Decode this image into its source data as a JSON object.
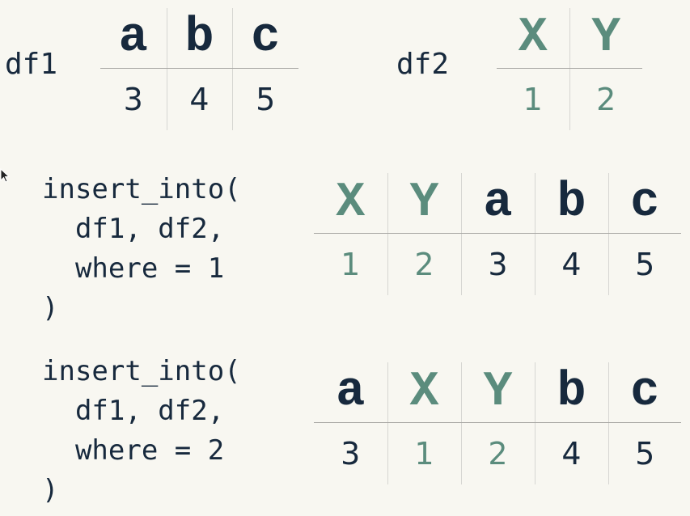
{
  "df1": {
    "label": "df1",
    "columns": [
      "a",
      "b",
      "c"
    ],
    "values": [
      "3",
      "4",
      "5"
    ]
  },
  "df2": {
    "label": "df2",
    "columns": [
      "X",
      "Y"
    ],
    "values": [
      "1",
      "2"
    ]
  },
  "example1": {
    "code": [
      "insert_into(",
      "  df1, df2,",
      "  where = 1",
      ")"
    ],
    "columns": [
      "X",
      "Y",
      "a",
      "b",
      "c"
    ],
    "values": [
      "1",
      "2",
      "3",
      "4",
      "5"
    ]
  },
  "example2": {
    "code": [
      "insert_into(",
      "  df1, df2,",
      "  where = 2",
      ")"
    ],
    "columns": [
      "a",
      "X",
      "Y",
      "b",
      "c"
    ],
    "values": [
      "3",
      "1",
      "2",
      "4",
      "5"
    ]
  },
  "colors": {
    "df1_color": "#17293d",
    "df2_color": "#5b8c7d",
    "background": "#f8f7f1"
  },
  "icons": {
    "cursor": "mouse-pointer-icon"
  }
}
